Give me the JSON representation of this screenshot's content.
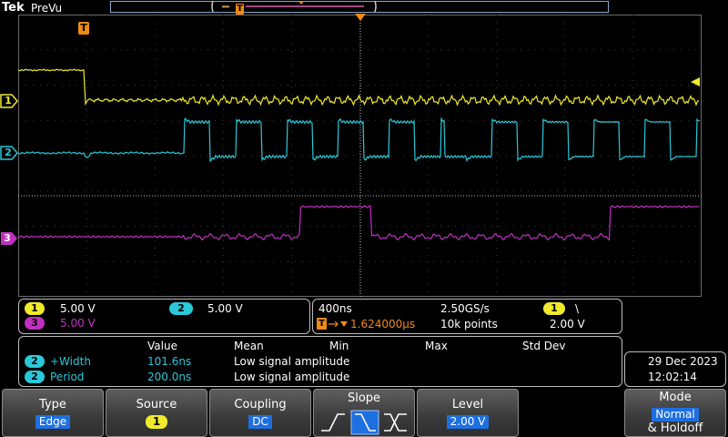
{
  "header": {
    "brand": "Tek",
    "mode": "PreVu",
    "trigger_marker": "T"
  },
  "graticule": {
    "trigger_label": "T",
    "colors": {
      "ch1": "#f0ea2a",
      "ch2": "#2ac8d8",
      "ch3": "#c030c0",
      "grid": "#5a5a5a",
      "trigger": "#f08a14"
    }
  },
  "channels": {
    "ch1_marker": "1",
    "ch2_marker": "2",
    "ch3_marker": "3"
  },
  "vertical": {
    "ch1": {
      "num": "1",
      "scale": "5.00 V"
    },
    "ch2": {
      "num": "2",
      "scale": "5.00 V"
    },
    "ch3": {
      "num": "3",
      "scale": "5.00 V"
    }
  },
  "timebase": {
    "time_per_div": "400ns",
    "sample_rate": "2.50GS/s",
    "trigger_source": "1",
    "slope_glyph": "\\",
    "trigger_position": "1.624000µs",
    "trigger_prefix": "T",
    "record_length": "10k points",
    "trigger_level": "2.00 V"
  },
  "measurements": {
    "headers": {
      "value": "Value",
      "mean": "Mean",
      "min": "Min",
      "max": "Max",
      "std": "Std Dev"
    },
    "rows": [
      {
        "ch": "2",
        "name": "+Width",
        "value": "101.6ns",
        "mean": "Low signal amplitude"
      },
      {
        "ch": "2",
        "name": "Period",
        "value": "200.0ns",
        "mean": "Low signal amplitude"
      }
    ]
  },
  "datetime": {
    "date": "29 Dec  2023",
    "time": "12:02:14"
  },
  "menu": {
    "type": {
      "label": "Type",
      "value": "Edge"
    },
    "source": {
      "label": "Source",
      "value": "1"
    },
    "coupling": {
      "label": "Coupling",
      "value": "DC"
    },
    "slope": {
      "label": "Slope",
      "selected": "falling"
    },
    "level": {
      "label": "Level",
      "value": "2.00 V"
    },
    "mode": {
      "label": "Mode",
      "value": "Normal",
      "sub": "& Holdoff"
    }
  }
}
